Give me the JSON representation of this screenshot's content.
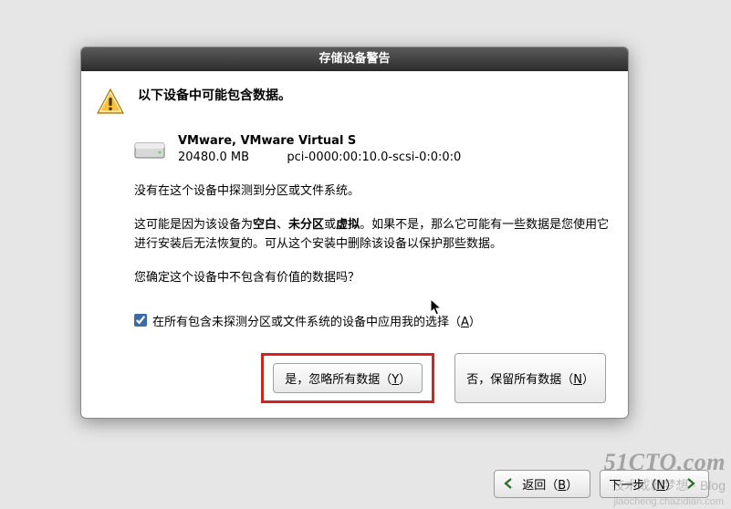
{
  "dialog": {
    "title": "存储设备警告",
    "heading": "以下设备中可能包含数据。",
    "device": {
      "name": "VMware, VMware Virtual S",
      "size": "20480.0 MB",
      "path": "pci-0000:00:10.0-scsi-0:0:0:0"
    },
    "para1": "没有在这个设备中探测到分区或文件系统。",
    "para2_pre": "这可能是因为该设备为",
    "para2_b1": "空白",
    "para2_sep1": "、",
    "para2_b2": "未分区",
    "para2_sep2": "或",
    "para2_b3": "虚拟",
    "para2_post": "。如果不是，那么它可能有一些数据是您使用它进行安装后无法恢复的。可从这个安装中删除该设备以保护那些数据。",
    "para3": "您确定这个设备中不包含有价值的数据吗？",
    "checkbox_label_pre": "在所有包含未探测分区或文件系统的设备中应用我的选择（",
    "checkbox_mnemonic": "A",
    "checkbox_label_post": "）",
    "checkbox_checked": true,
    "btn_discard_pre": "是，忽略所有数据（",
    "btn_discard_mnemonic": "Y",
    "btn_discard_post": "）",
    "btn_keep_pre": "否，保留所有数据（",
    "btn_keep_mnemonic": "N",
    "btn_keep_post": "）"
  },
  "nav": {
    "back_pre": "返回（",
    "back_mnemonic": "B",
    "back_post": "）",
    "next_pre": "下一步（",
    "next_mnemonic": "N",
    "next_post": "）"
  },
  "watermark": {
    "line1": "51CTO.com",
    "line2": "技术成就梦想 · Blog",
    "line3": "jiaocheng.chazidian.com"
  }
}
